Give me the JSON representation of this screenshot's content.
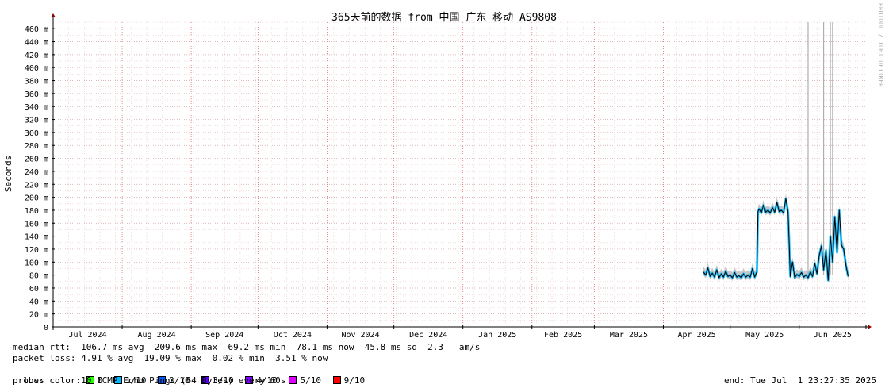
{
  "chart_data": {
    "type": "line",
    "title": "365天前的数据 from 中国 广东 移动 AS9808",
    "ylabel": "Seconds",
    "watermark": "RRDTOOL / TOBI OETIKER",
    "ylim": [
      0,
      470
    ],
    "yticks": [
      {
        "v": 0,
        "label": "0"
      },
      {
        "v": 20,
        "label": "20 m"
      },
      {
        "v": 40,
        "label": "40 m"
      },
      {
        "v": 60,
        "label": "60 m"
      },
      {
        "v": 80,
        "label": "80 m"
      },
      {
        "v": 100,
        "label": "100 m"
      },
      {
        "v": 120,
        "label": "120 m"
      },
      {
        "v": 140,
        "label": "140 m"
      },
      {
        "v": 160,
        "label": "160 m"
      },
      {
        "v": 180,
        "label": "180 m"
      },
      {
        "v": 200,
        "label": "200 m"
      },
      {
        "v": 220,
        "label": "220 m"
      },
      {
        "v": 240,
        "label": "240 m"
      },
      {
        "v": 260,
        "label": "260 m"
      },
      {
        "v": 280,
        "label": "280 m"
      },
      {
        "v": 300,
        "label": "300 m"
      },
      {
        "v": 320,
        "label": "320 m"
      },
      {
        "v": 340,
        "label": "340 m"
      },
      {
        "v": 360,
        "label": "360 m"
      },
      {
        "v": 380,
        "label": "380 m"
      },
      {
        "v": 400,
        "label": "400 m"
      },
      {
        "v": 420,
        "label": "420 m"
      },
      {
        "v": 440,
        "label": "440 m"
      },
      {
        "v": 460,
        "label": "460 m"
      }
    ],
    "xlim": [
      0,
      365
    ],
    "month_boundaries": [
      0,
      31,
      62,
      92,
      123,
      153,
      184,
      215,
      243,
      274,
      304,
      335,
      365
    ],
    "xtick_labels": [
      "Jul 2024",
      "Aug 2024",
      "Sep 2024",
      "Oct 2024",
      "Nov 2024",
      "Dec 2024",
      "Jan 2025",
      "Feb 2025",
      "Mar 2025",
      "Apr 2025",
      "May 2025",
      "Jun 2025"
    ],
    "grid": true,
    "median_series": [
      [
        292,
        85
      ],
      [
        293,
        80
      ],
      [
        294,
        91
      ],
      [
        295,
        78
      ],
      [
        296,
        83
      ],
      [
        297,
        77
      ],
      [
        298,
        88
      ],
      [
        299,
        76
      ],
      [
        300,
        82
      ],
      [
        301,
        77
      ],
      [
        302,
        86
      ],
      [
        303,
        78
      ],
      [
        304,
        80
      ],
      [
        305,
        76
      ],
      [
        306,
        84
      ],
      [
        307,
        77
      ],
      [
        308,
        79
      ],
      [
        309,
        76
      ],
      [
        310,
        82
      ],
      [
        311,
        77
      ],
      [
        312,
        80
      ],
      [
        313,
        77
      ],
      [
        314,
        90
      ],
      [
        315,
        77
      ],
      [
        316,
        85
      ],
      [
        316.5,
        178
      ],
      [
        317,
        182
      ],
      [
        318,
        176
      ],
      [
        319,
        188
      ],
      [
        320,
        177
      ],
      [
        321,
        180
      ],
      [
        322,
        176
      ],
      [
        323,
        184
      ],
      [
        324,
        177
      ],
      [
        325,
        192
      ],
      [
        326,
        178
      ],
      [
        327,
        180
      ],
      [
        328,
        176
      ],
      [
        329,
        198
      ],
      [
        330,
        177
      ],
      [
        330.5,
        130
      ],
      [
        331,
        78
      ],
      [
        332,
        100
      ],
      [
        333,
        76
      ],
      [
        334,
        81
      ],
      [
        335,
        78
      ],
      [
        336,
        84
      ],
      [
        337,
        77
      ],
      [
        338,
        80
      ],
      [
        339,
        76
      ],
      [
        340,
        85
      ],
      [
        341,
        78
      ],
      [
        342,
        98
      ],
      [
        343,
        82
      ],
      [
        344,
        110
      ],
      [
        345,
        125
      ],
      [
        346,
        88
      ],
      [
        347,
        118
      ],
      [
        348,
        72
      ],
      [
        349,
        140
      ],
      [
        350,
        100
      ],
      [
        351,
        170
      ],
      [
        352,
        115
      ],
      [
        353,
        180
      ],
      [
        354,
        126
      ],
      [
        355,
        120
      ],
      [
        356,
        95
      ],
      [
        357,
        78
      ]
    ],
    "spikes": [
      [
        339,
        470
      ],
      [
        346,
        470
      ],
      [
        349,
        470
      ],
      [
        350,
        470
      ]
    ],
    "stats": {
      "median_rtt": "median rtt:  106.7 ms avg  209.6 ms max  69.2 ms min  78.1 ms now  45.8 ms sd  2.3   am/s",
      "packet_loss": "packet loss: 4.91 % avg  19.09 % max  0.02 % min  3.51 % now",
      "loss_color_label": "loss color:",
      "probe": "probe:       10 ICMP Echo Pings (64 Bytes) every 60s",
      "end": "end: Tue Jul  1 23:27:35 2025"
    },
    "loss_colors": [
      {
        "label": "0",
        "color": "#26ff00"
      },
      {
        "label": "1/10",
        "color": "#00b8ff"
      },
      {
        "label": "2/10",
        "color": "#0059ff"
      },
      {
        "label": "3/10",
        "color": "#5e00ff"
      },
      {
        "label": "4/10",
        "color": "#7e00ff"
      },
      {
        "label": "5/10",
        "color": "#dd00ff"
      },
      {
        "label": "9/10",
        "color": "#ff0000"
      }
    ],
    "colors": {
      "median": "#000000",
      "median_band": "#00b8ff",
      "smoke": "#a0a0a0",
      "grid_minor": "#e8c8c8",
      "grid_major": "#e07070",
      "axis": "#000000",
      "arrow": "#8b0000"
    }
  }
}
